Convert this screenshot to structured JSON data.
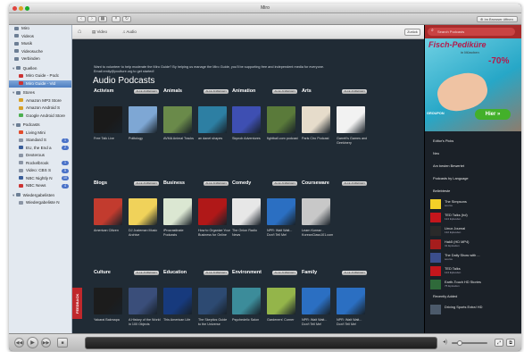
{
  "window": {
    "title": "Miro"
  },
  "toolbar": {
    "nav_button_icon": "grid-icon",
    "right_button_label": "Im Browser öffnen"
  },
  "sidebar": {
    "items": [
      {
        "label": "Miro",
        "color": "#6d7f95"
      },
      {
        "label": "Videos",
        "color": "#6d7f95"
      },
      {
        "label": "Musik",
        "color": "#6d7f95"
      },
      {
        "label": "Videosuche",
        "color": "#6d7f95"
      },
      {
        "label": "Verbinden",
        "color": "#6d7f95"
      },
      {
        "label": "Quellen",
        "color": "#6d7f95"
      },
      {
        "label": "Miro Guide - Podc",
        "color": "#c33"
      },
      {
        "label": "Miro Guide - Vid",
        "color": "#c33",
        "selected": true
      },
      {
        "label": "Stores",
        "color": "#6d7f95"
      },
      {
        "label": "Amazon MP3 Store",
        "color": "#d7a12a"
      },
      {
        "label": "Amazon Android S",
        "color": "#d7a12a"
      },
      {
        "label": "Google Android Store",
        "color": "#4caf50"
      },
      {
        "label": "Podcasts",
        "color": "#6d7f95"
      },
      {
        "label": "Living Mini",
        "color": "#e24c2c",
        "badge": ""
      },
      {
        "label": "Standard S",
        "color": "#8b95a5",
        "badge": "1"
      },
      {
        "label": "EU, the End a",
        "color": "#3a5e9a",
        "badge": "2"
      },
      {
        "label": "Dexterous",
        "color": "#8b95a5",
        "badge": ""
      },
      {
        "label": "Rockelbrook",
        "color": "#8b95a5",
        "badge": "1"
      },
      {
        "label": "Video: CBS S",
        "color": "#8b95a5",
        "badge": "5"
      },
      {
        "label": "NBC Nightly N",
        "color": "#3a5e9a",
        "badge": "10"
      },
      {
        "label": "NBC News",
        "color": "#c33",
        "badge": "4"
      },
      {
        "label": "Wiedergabelisten",
        "color": "#6d7f95"
      },
      {
        "label": "Wiedergabeliste N",
        "color": "#8b95a5"
      }
    ]
  },
  "navbar": {
    "tabs": [
      {
        "label": "Video",
        "icon": "film-icon"
      },
      {
        "label": "Audio",
        "icon": "audio-icon"
      }
    ],
    "home_icon": "home-icon",
    "back_label": "Zurück"
  },
  "search": {
    "placeholder": "Search Podcasts"
  },
  "intro": {
    "line1": "Want to volunteer to help moderate the Miro Guide? By helping us manage the Miro Guide, you'll be supporting free and independent media for everyone.",
    "line2": "Email emily@pculture.org to get started!",
    "heading": "Audio Podcasts"
  },
  "see_all_label": "ALLE ANZEIGEN",
  "sections": [
    {
      "name": "Activism",
      "items": [
        {
          "title": "Free Talk Live",
          "color": "#1a1a1a"
        },
        {
          "title": "Politology",
          "color": "#7ea7d4"
        }
      ]
    },
    {
      "name": "Animals",
      "items": [
        {
          "title": "AVMA Animal Tracks",
          "color": "#6a8a4a"
        },
        {
          "title": "an danet shapes",
          "color": "#2d7fa3"
        }
      ]
    },
    {
      "name": "Animation",
      "items": [
        {
          "title": "Skynob Adventures",
          "color": "#3e4fb2"
        },
        {
          "title": "fightball.com podcast",
          "color": "#5a7a3a"
        }
      ]
    },
    {
      "name": "Arts",
      "items": [
        {
          "title": "Paris Ciro Podcast",
          "color": "#e6dccb"
        },
        {
          "title": "Garrett's Games and Geekinery",
          "color": "#f2f2f2"
        }
      ]
    },
    {
      "name": "Blogs",
      "items": [
        {
          "title": "American Citizen",
          "color": "#c23b2e"
        },
        {
          "title": "DJ Justeman Music Archive",
          "color": "#f0d25a"
        }
      ]
    },
    {
      "name": "Business",
      "items": [
        {
          "title": "iProcrastinate Podcasts",
          "color": "#dbe7d2"
        },
        {
          "title": "How to Organize Your Business for Online",
          "color": "#b01818"
        }
      ]
    },
    {
      "name": "Comedy",
      "items": [
        {
          "title": "The Onion Radio News",
          "color": "#e7e7e7"
        },
        {
          "title": "NPR: Wait Wait... Don't Tell Me!",
          "color": "#2b6fc2"
        }
      ]
    },
    {
      "name": "Courseware",
      "items": [
        {
          "title": "Learn Korean - KoreanClass101.com",
          "color": "#c8c8c8"
        }
      ]
    },
    {
      "name": "Culture",
      "items": [
        {
          "title": "Yakarai Bakmapa",
          "color": "#1c1c1c"
        },
        {
          "title": "A History of the World in 100 Objects",
          "color": "#3a4e7a"
        }
      ]
    },
    {
      "name": "Education",
      "items": [
        {
          "title": "This American Life",
          "color": "#173a7d"
        },
        {
          "title": "The Skeptics Guide to the Universe",
          "color": "#2d4a72"
        }
      ]
    },
    {
      "name": "Environment",
      "items": [
        {
          "title": "Psychedelic Salon",
          "color": "#3c8c9a"
        },
        {
          "title": "Gardeners' Corner",
          "color": "#94b54a"
        }
      ]
    },
    {
      "name": "Family",
      "items": [
        {
          "title": "NPR: Wait Wait... Don't Tell Me!",
          "color": "#2b6fc2"
        },
        {
          "title": "NPR: Wait Wait... Don't Tell Me!",
          "color": "#2b6fc2"
        }
      ]
    }
  ],
  "feedback_label": "FEEDBACK",
  "ad": {
    "title": "Fisch-Pediküre",
    "subtitle": "in München",
    "badge": "-70%",
    "brand": "GROUPON",
    "button": "Hier »"
  },
  "right_menu": [
    "Editor's Picks",
    "Neu",
    "Am besten Bewertet",
    "Podcasts by Language",
    "Beliebteste"
  ],
  "popular": [
    {
      "title": "The Simpsons",
      "sub": "source",
      "color": "#f3d028"
    },
    {
      "title": "TED Talks (hd)",
      "sub": "124 Episoden",
      "color": "#c4161c"
    },
    {
      "title": "Linux Journal",
      "sub": "132 Episoden",
      "color": "#2a2a2a"
    },
    {
      "title": "Hak5 (HD MP4)",
      "sub": "31 Episoden",
      "color": "#a61d1d"
    },
    {
      "title": "The Daily Show with ...",
      "sub": "source",
      "color": "#3b4e8c"
    },
    {
      "title": "TED Talks",
      "sub": "124 Episoden",
      "color": "#c4161c"
    },
    {
      "title": "Earth-Touch HD Stories",
      "sub": "75 Episoden",
      "color": "#2f6a3a"
    }
  ],
  "recently_added_label": "Recently Added",
  "recent": [
    {
      "title": "Driving Sports Extra! HD",
      "sub": "",
      "color": "#4c5a6b"
    }
  ]
}
